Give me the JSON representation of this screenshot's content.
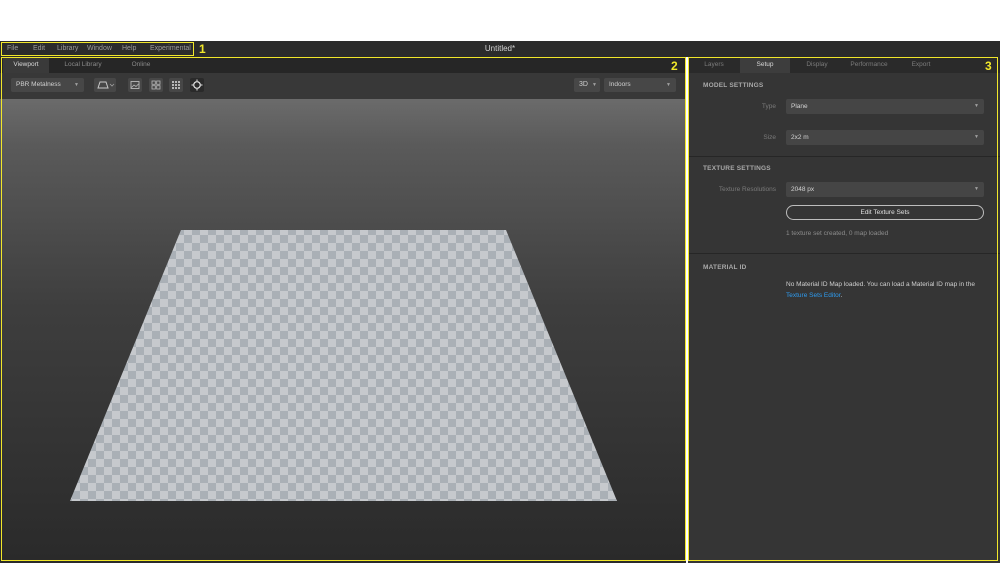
{
  "menubar": {
    "items": [
      "File",
      "Edit",
      "Library",
      "Window",
      "Help",
      "Experimental"
    ],
    "window_title": "Untitled*"
  },
  "annotations": [
    "1",
    "2",
    "3"
  ],
  "viewport": {
    "tabs": [
      "Viewport",
      "Local Library",
      "Online"
    ],
    "active_tab": "Viewport",
    "shader_dropdown": "PBR Metalness",
    "view_mode": "3D",
    "environment": "Indoors",
    "icons": [
      "camera-perspective-icon",
      "image-icon",
      "grid-2x2-icon",
      "grid-3x3-icon",
      "light-icon"
    ]
  },
  "right_panel": {
    "tabs": [
      "Layers",
      "Setup",
      "Display",
      "Performance",
      "Export"
    ],
    "active_tab": "Setup",
    "model_settings": {
      "title": "MODEL SETTINGS",
      "type_label": "Type",
      "type_value": "Plane",
      "size_label": "Size",
      "size_value": "2x2 m"
    },
    "texture_settings": {
      "title": "TEXTURE SETTINGS",
      "resolution_label": "Texture Resolutions",
      "resolution_value": "2048 px",
      "edit_button": "Edit Texture Sets",
      "status": "1 texture set created, 0 map loaded"
    },
    "material_id": {
      "title": "MATERIAL ID",
      "message": "No Material ID Map loaded. You can load a Material ID map in the",
      "link": "Texture Sets Editor",
      "link_suffix": "."
    }
  },
  "colors": {
    "annotation": "#f1e72a",
    "link": "#2e9cf0",
    "panel_bg": "#353535"
  }
}
